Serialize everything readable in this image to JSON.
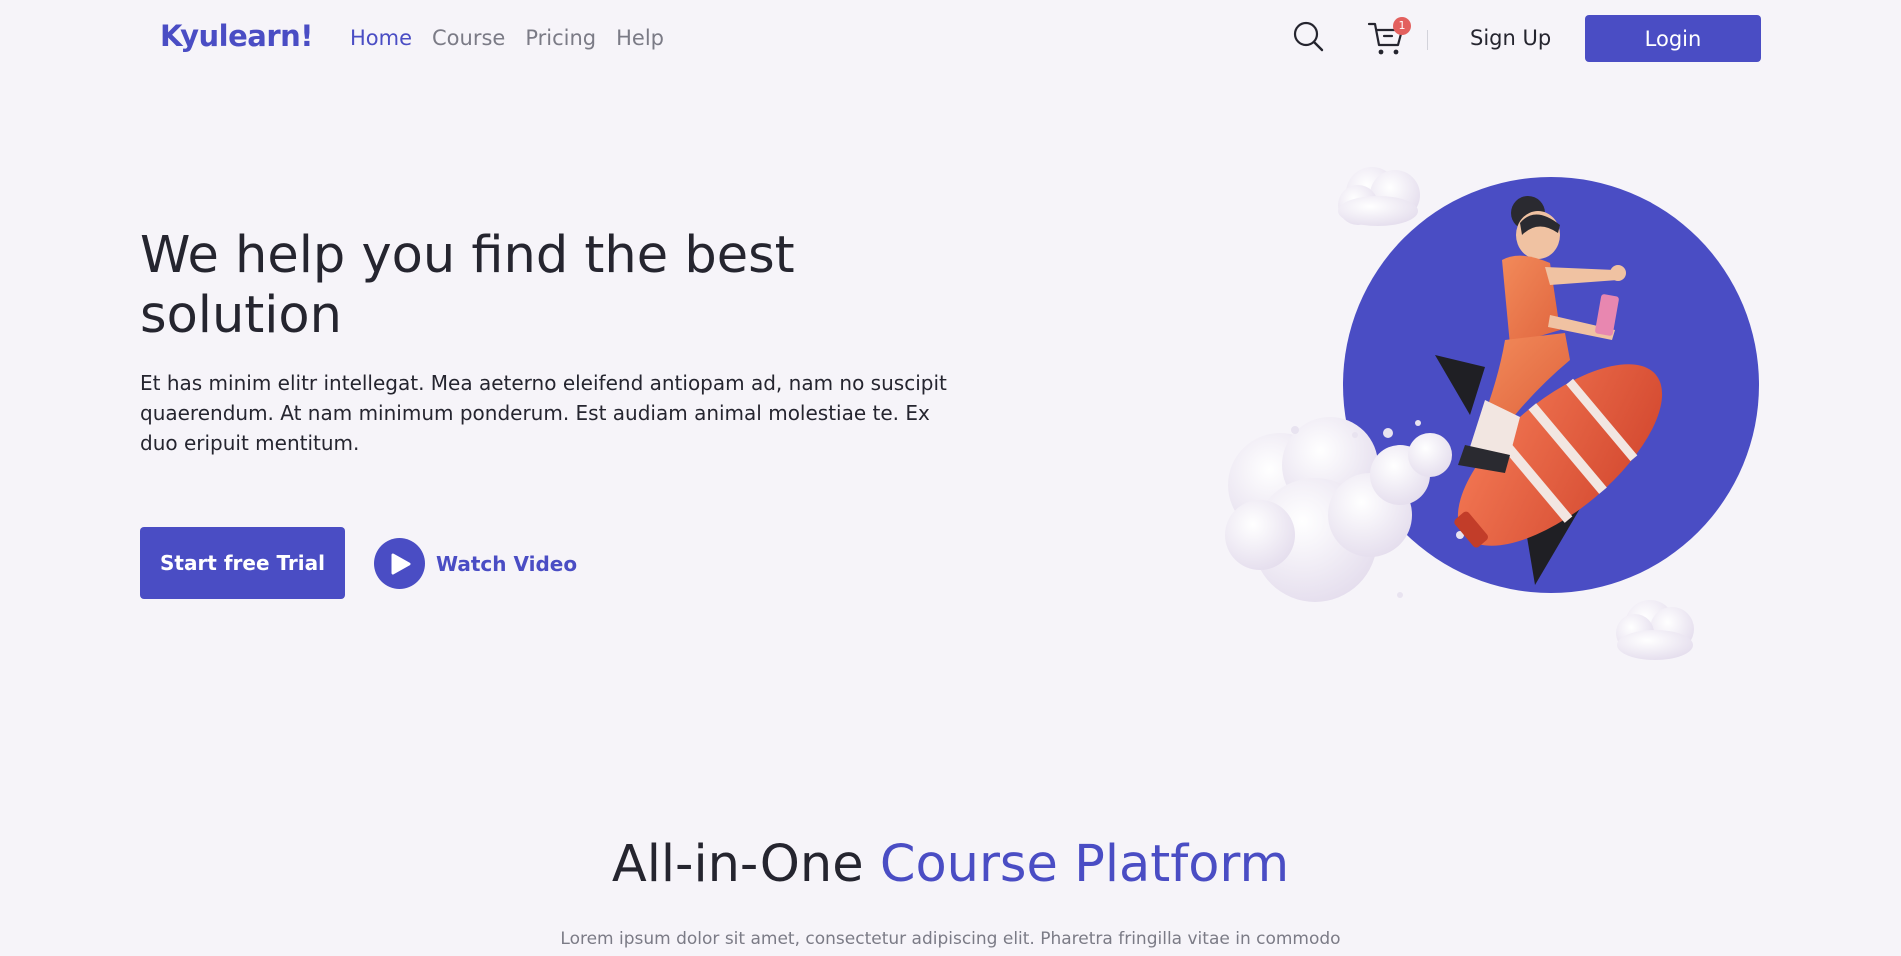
{
  "brand": {
    "name": "Kyulearn!",
    "accent_color": "#4a4dc4"
  },
  "nav": {
    "links": [
      {
        "label": "Home",
        "active": true
      },
      {
        "label": "Course",
        "active": false
      },
      {
        "label": "Pricing",
        "active": false
      },
      {
        "label": "Help",
        "active": false
      }
    ],
    "search_icon": "search-icon",
    "cart_icon": "cart-icon",
    "cart_count": "1",
    "signup_label": "Sign Up",
    "login_label": "Login"
  },
  "hero": {
    "title": "We help you find the best solution",
    "text": "Et has minim elitr intellegat. Mea aeterno eleifend antiopam ad, nam no suscipit quaerendum. At nam minimum ponderum. Est audiam animal molestiae te. Ex duo eripuit mentitum.",
    "trial_label": "Start free Trial",
    "watch_label": "Watch Video",
    "illustration": "rocket-rider-illustration"
  },
  "section": {
    "title_plain": "All-in-One",
    "title_accent": "Course Platform",
    "subtitle": "Lorem ipsum dolor sit amet, consectetur adipiscing elit. Pharetra fringilla vitae in commodo"
  }
}
